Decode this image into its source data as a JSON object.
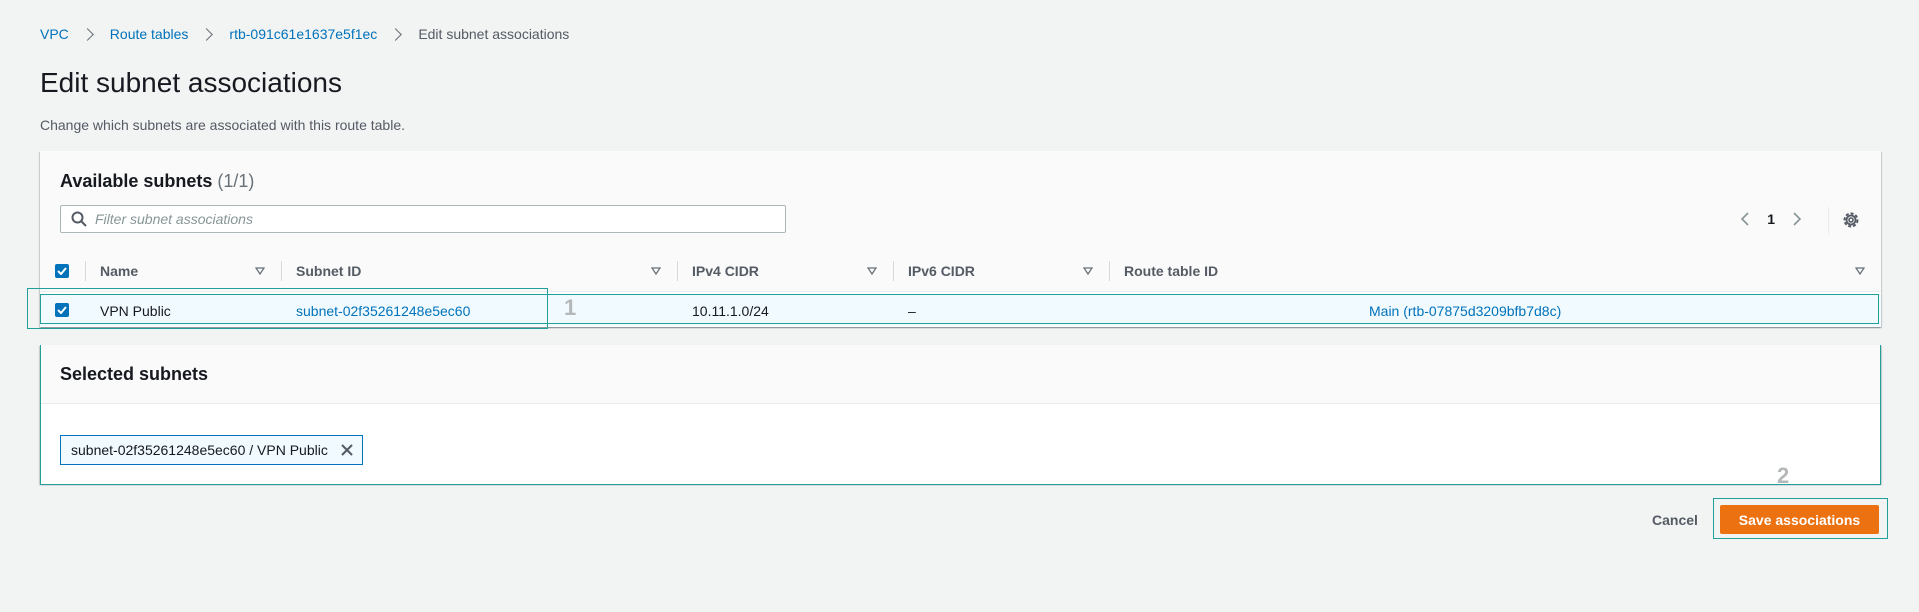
{
  "breadcrumb": {
    "items": [
      "VPC",
      "Route tables",
      "rtb-091c61e1637e5f1ec"
    ],
    "current": "Edit subnet associations"
  },
  "page": {
    "title": "Edit subnet associations",
    "description": "Change which subnets are associated with this route table."
  },
  "available": {
    "title": "Available subnets",
    "count": "(1/1)",
    "search_placeholder": "Filter subnet associations",
    "page_number": "1",
    "columns": [
      "Name",
      "Subnet ID",
      "IPv4 CIDR",
      "IPv6 CIDR",
      "Route table ID"
    ],
    "rows": [
      {
        "name": "VPN Public",
        "subnet_id": "subnet-02f35261248e5ec60",
        "ipv4_cidr": "10.11.1.0/24",
        "ipv6_cidr": "–",
        "route_table_id": "Main (rtb-07875d3209bfb7d8c)"
      }
    ]
  },
  "selected": {
    "title": "Selected subnets",
    "tokens": [
      "subnet-02f35261248e5ec60 / VPN Public"
    ]
  },
  "actions": {
    "cancel_label": "Cancel",
    "save_label": "Save associations"
  },
  "annotations": {
    "step1": "1",
    "step2": "2"
  },
  "colors": {
    "link": "#0073bb",
    "primary_button": "#ec7211",
    "highlight": "#20a09a",
    "background": "#f2f3f3"
  }
}
